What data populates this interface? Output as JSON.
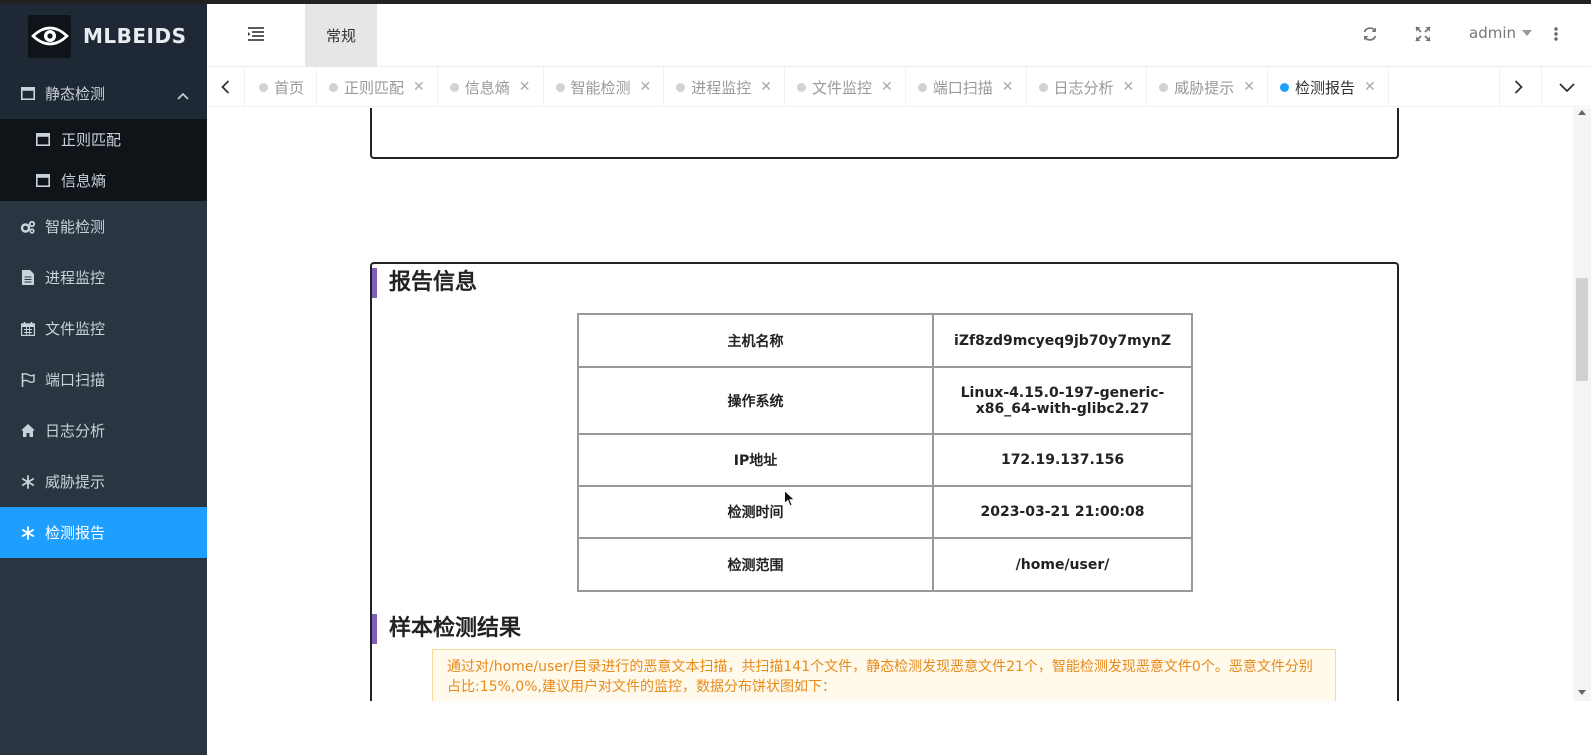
{
  "app": {
    "brand": "MLBEIDS"
  },
  "header": {
    "tab_general": "常规",
    "user": "admin"
  },
  "sidebar": {
    "items": [
      {
        "label": "静态检测",
        "icon": "window-icon",
        "expanded": true,
        "children": [
          {
            "label": "正则匹配",
            "icon": "window-icon"
          },
          {
            "label": "信息熵",
            "icon": "window-icon"
          }
        ]
      },
      {
        "label": "智能检测",
        "icon": "gears-icon"
      },
      {
        "label": "进程监控",
        "icon": "file-icon"
      },
      {
        "label": "文件监控",
        "icon": "calendar-icon"
      },
      {
        "label": "端口扫描",
        "icon": "flag-icon"
      },
      {
        "label": "日志分析",
        "icon": "home-icon"
      },
      {
        "label": "威胁提示",
        "icon": "snowflake-icon"
      },
      {
        "label": "检测报告",
        "icon": "snowflake-icon",
        "active": true
      }
    ]
  },
  "tabs": [
    {
      "label": "首页",
      "closable": false
    },
    {
      "label": "正则匹配",
      "closable": true
    },
    {
      "label": "信息熵",
      "closable": true
    },
    {
      "label": "智能检测",
      "closable": true
    },
    {
      "label": "进程监控",
      "closable": true
    },
    {
      "label": "文件监控",
      "closable": true
    },
    {
      "label": "端口扫描",
      "closable": true
    },
    {
      "label": "日志分析",
      "closable": true
    },
    {
      "label": "威胁提示",
      "closable": true
    },
    {
      "label": "检测报告",
      "closable": true,
      "active": true
    }
  ],
  "report": {
    "section_info": "报告信息",
    "rows": [
      {
        "key": "主机名称",
        "value": "iZf8zd9mcyeq9jb70y7mynZ"
      },
      {
        "key": "操作系统",
        "value": "Linux-4.15.0-197-generic-x86_64-with-glibc2.27"
      },
      {
        "key": "IP地址",
        "value": "172.19.137.156"
      },
      {
        "key": "检测时间",
        "value": "2023-03-21 21:00:08"
      },
      {
        "key": "检测范围",
        "value": "/home/user/"
      }
    ],
    "section_result": "样本检测结果",
    "summary": "通过对/home/user/目录进行的恶意文本扫描，共扫描141个文件，静态检测发现恶意文件21个，智能检测发现恶意文件0个。恶意文件分别占比:15%,0%,建议用户对文件的监控，数据分布饼状图如下："
  },
  "colors": {
    "sidebar_bg": "#2a3542",
    "active": "#1e9fff",
    "accent_bar": "#7f5fb8",
    "note_text": "#e68a1c"
  }
}
